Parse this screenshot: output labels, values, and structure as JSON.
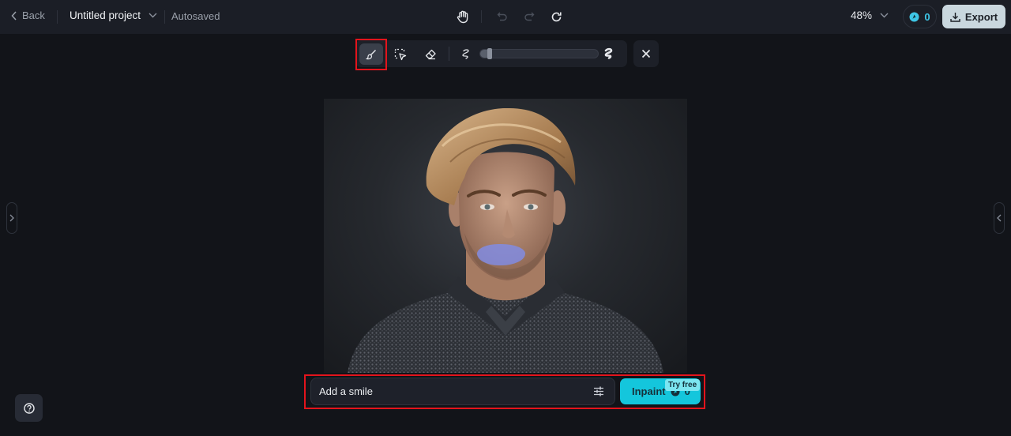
{
  "topbar": {
    "back_label": "Back",
    "project_name": "Untitled project",
    "save_status": "Autosaved",
    "zoom_level": "48%",
    "credits": "0",
    "export_label": "Export",
    "icons": [
      "chevron-left-icon",
      "chevron-down-icon",
      "hand-icon",
      "undo-icon",
      "redo-icon",
      "refresh-icon",
      "credit-icon",
      "download-icon"
    ]
  },
  "brush_toolbar": {
    "tools": [
      {
        "name": "brush",
        "icon": "brush-icon",
        "active": true
      },
      {
        "name": "smart-select",
        "icon": "select-cursor-icon",
        "active": false
      },
      {
        "name": "eraser",
        "icon": "eraser-icon",
        "active": false
      }
    ],
    "brush_size_percent": 6,
    "close_icon": "close-icon"
  },
  "canvas": {
    "image_description": "Portrait of a young man with wavy blond hair in a dark knit sweater, mouth area masked in blue"
  },
  "prompt": {
    "value": "Add a smile",
    "settings_icon": "sliders-icon",
    "inpaint_label": "Inpaint",
    "inpaint_cost": "0",
    "badge": "Try free"
  },
  "help_icon": "help-icon",
  "colors": {
    "accent": "#14c6dc",
    "highlight": "#e3141c",
    "mask": "#808ce6"
  }
}
